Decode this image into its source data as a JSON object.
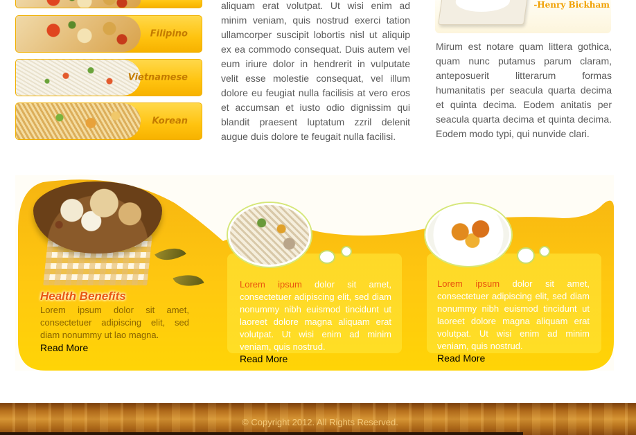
{
  "categories": [
    {
      "label": ""
    },
    {
      "label": "Filipino"
    },
    {
      "label": "Vietnamese"
    },
    {
      "label": "Korean"
    }
  ],
  "column_middle": {
    "text": "aliquam erat volutpat. Ut wisi enim ad minim veniam, quis nostrud exerci tation ullamcorper suscipit lobortis nisl ut aliquip ex ea commodo consequat. Duis autem vel eum iriure dolor in hendrerit in vulputate velit esse molestie consequat, vel illum dolore eu feugiat nulla facilisis at vero eros et accumsan et iusto odio dignissim qui blandit praesent luptatum zzril delenit augue duis dolore te feugait nulla facilisi."
  },
  "column_right": {
    "quote_author": "-Henry Bickham",
    "text": "Mirum est notare quam littera gothica, quam nunc putamus parum claram, anteposuerit litterarum formas humanitatis per seacula quarta decima et quinta decima. Eodem anitatis per seacula quarta decima et quinta decima. Eodem modo typi, qui nunvide clari."
  },
  "features": [
    {
      "title": "Health Benefits",
      "text": "Lorem ipsum dolor sit amet, consectetuer adipiscing elit, sed diam nonummy ut lao magna.",
      "read_more": "Read More"
    },
    {
      "highlight": "Lorem ipsum",
      "text": " dolor sit amet, consectetuer adipiscing elit, sed diam nonummy nibh euismod tincidunt ut laoreet dolore magna aliquam erat volutpat. Ut wisi enim ad minim veniam, quis nostrud.",
      "read_more": "Read More"
    },
    {
      "highlight": "Lorem ipsum",
      "text": " dolor sit amet, consectetuer adipiscing elit, sed diam nonummy nibh euismod tincidunt ut laoreet dolore magna aliquam erat volutpat. Ut wisi enim ad minim veniam, quis nostrud.",
      "read_more": "Read More"
    }
  ],
  "footer": {
    "copyright": "© Copyright 2012. All Rights Reserved."
  },
  "colors": {
    "accent": "#ffc30f",
    "highlight": "#e8530e",
    "category_label": "#c47b00",
    "quote_author": "#f0a000"
  }
}
